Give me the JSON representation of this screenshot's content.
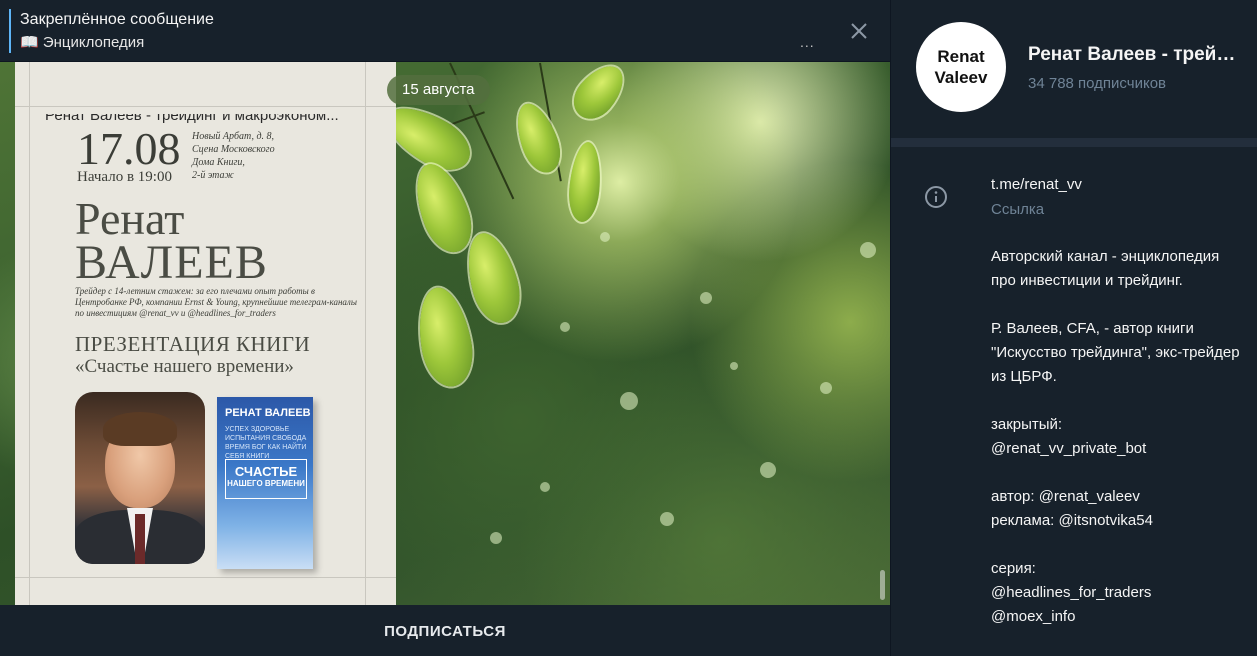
{
  "pinned": {
    "title": "Закреплённое сообщение",
    "subtitle": "📖 Энциклопедия",
    "more": "...",
    "close_icon": "close-icon"
  },
  "post": {
    "top_caption": "Ренат Валеев - трейдинг и макроэконом...",
    "event_date": "17.08",
    "event_time": "Начало в 19:00",
    "venue_line1": "Новый Арбат, д. 8,",
    "venue_line2": "Сцена Московского",
    "venue_line3": "Дома Книги,",
    "venue_line4": "2-й этаж",
    "name_first": "Ренат",
    "name_last": "ВАЛЕЕВ",
    "bio": "Трейдер с 14-летним стажем: за его плечами опыт работы в Центробанке РФ, компании Ernst & Young, крупнейшие телеграм-каналы по инвестициям @renat_vv и @headlines_for_traders",
    "presentation_title": "ПРЕЗЕНТАЦИЯ КНИГИ",
    "book_title": "«Счастье нашего времени»",
    "book_cover": {
      "author": "РЕНАТ ВАЛЕЕВ",
      "words": "УСПЕХ ЗДОРОВЬЕ ИСПЫТАНИЯ СВОБОДА ВРЕМЯ БОГ КАК НАЙТИ СЕБЯ КНИГИ",
      "title_main": "СЧАСТЬЕ",
      "title_sub": "НАШЕГО ВРЕМЕНИ"
    }
  },
  "date_bubble": "15 августа",
  "subscribe_label": "ПОДПИСАТЬСЯ",
  "channel": {
    "avatar_line1": "Renat",
    "avatar_line2": "Valeev",
    "name": "Ренат Валеев - трейдинг и макроэкономика",
    "subscribers": "34 788 подписчиков",
    "link": "t.me/renat_vv",
    "link_caption": "Ссылка",
    "description": "Авторский канал - энциклопедия про инвестиции и трейдинг.\n\nР. Валеев, CFA, - автор книги \"Искусство трейдинга\", экс-трейдер из ЦБРФ.\n\nзакрытый:\n@renat_vv_private_bot\n\nавтор: @renat_valeev\nреклама: @itsnotvika54\n\nсерия:\n@headlines_for_traders\n@moex_info"
  },
  "colors": {
    "background": "#17212b",
    "accent": "#5eb5f7",
    "muted_text": "#6f8396"
  }
}
